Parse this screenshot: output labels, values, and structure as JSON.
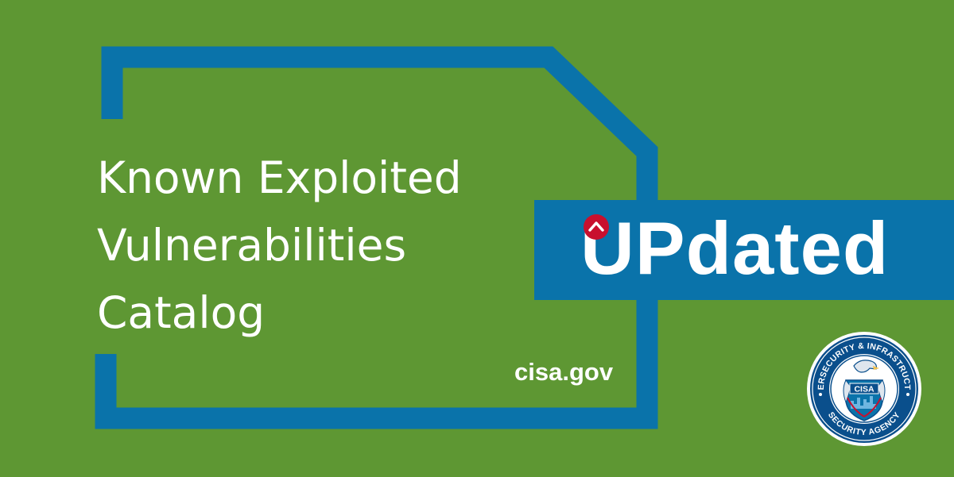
{
  "title": {
    "lines": [
      "Known Exploited",
      "Vulnerabilities",
      "Catalog"
    ]
  },
  "website": "cisa.gov",
  "banner": {
    "word": "UPdated",
    "caret_icon": "up-chevron-in-red-circle"
  },
  "seal": {
    "top_text": "CYBERSECURITY & INFRASTRUCTURE",
    "bottom_text": "SECURITY AGENCY",
    "center_text": "CISA",
    "icon": "cisa-eagle-seal"
  },
  "colors": {
    "background": "#5e9733",
    "frame": "#0a73aa",
    "banner": "#0a73aa",
    "caret_circle": "#c8102e",
    "text": "#ffffff"
  }
}
